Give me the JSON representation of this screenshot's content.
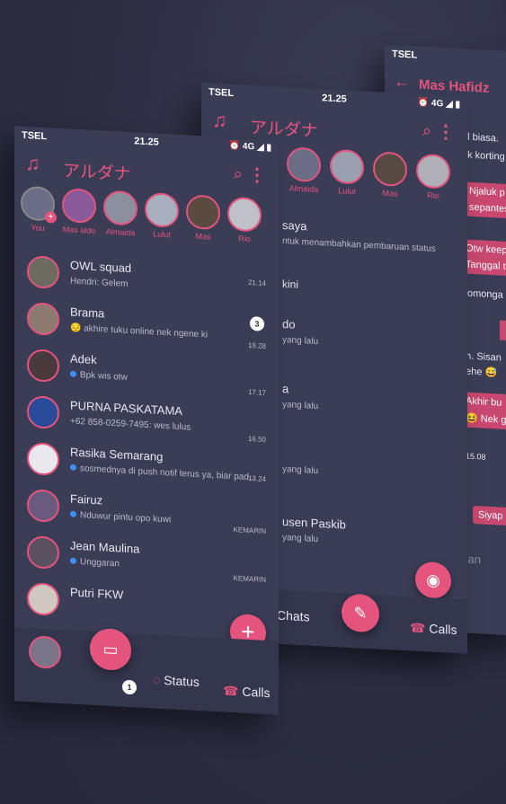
{
  "status": {
    "carrier": "TSEL",
    "time": "21.25",
    "icons": "⏰ 4G ◢ ▮"
  },
  "app": {
    "title": "アルダナ"
  },
  "stories": [
    {
      "name": "You"
    },
    {
      "name": "Mas aldo"
    },
    {
      "name": "Almaida"
    },
    {
      "name": "Lulut"
    },
    {
      "name": "Mas"
    },
    {
      "name": "Rio"
    }
  ],
  "chats": [
    {
      "name": "OWL squad",
      "message": "Hendri: Gelem",
      "time": "21.14"
    },
    {
      "name": "Brama",
      "message": "😔 akhire tuku online nek ngene ki",
      "time": "19.28",
      "unread": "3"
    },
    {
      "name": "Adek",
      "message": "Bpk wis otw",
      "time": "17.17"
    },
    {
      "name": "PURNA PASKATAMA",
      "message": "+62 858-0259-7495: wes lulus",
      "time": "16.50"
    },
    {
      "name": "Rasika Semarang",
      "message": "sosmednya di push notif terus ya, biar pad...",
      "time": "13.24"
    },
    {
      "name": "Fairuz",
      "message": "Nduwur pintu opo kuwi",
      "time": "KEMARIN"
    },
    {
      "name": "Jean Maulina",
      "message": "Unggaran",
      "time": "KEMARIN"
    },
    {
      "name": "Putri FKW",
      "message": "",
      "time": ""
    }
  ],
  "bottom": {
    "status": "Status",
    "calls": "Calls",
    "chats": "Chats",
    "badge": "1"
  },
  "status_screen": {
    "my_name": "saya",
    "my_hint": "ntuk menambahkan pembaruan status",
    "section": "kini",
    "rows": [
      {
        "name": "do",
        "time": "yang lalu"
      },
      {
        "name": "a",
        "time": "yang lalu"
      },
      {
        "name": "",
        "time": "yang lalu"
      },
      {
        "name": "usen Paskib",
        "time": "yang lalu"
      }
    ]
  },
  "chat_screen": {
    "title": "Mas Hafidz",
    "lines": [
      {
        "text": "al biasa.",
        "kind": "in"
      },
      {
        "text": "ak korting",
        "kind": "in"
      },
      {
        "text": "Njaluk p",
        "kind": "out"
      },
      {
        "text": "sepantes",
        "kind": "out"
      },
      {
        "text": "Otw keep",
        "kind": "out"
      },
      {
        "text": "Tanggal tu",
        "kind": "out"
      },
      {
        "text": "omonga",
        "kind": "in"
      },
      {
        "text": "uh. Sisan",
        "kind": "in"
      },
      {
        "text": "hehe 😅",
        "kind": "in"
      },
      {
        "text": "Akhir bu",
        "kind": "out"
      },
      {
        "text": "😆 Nek gal",
        "kind": "out"
      },
      {
        "text": "15.08",
        "kind": "in"
      },
      {
        "text": "Siyap",
        "kind": "out"
      },
      {
        "text": "san",
        "kind": "in"
      }
    ]
  },
  "colors": {
    "accent": "#e4547d",
    "panel": "#3b3d57",
    "background": "#2f3045"
  }
}
